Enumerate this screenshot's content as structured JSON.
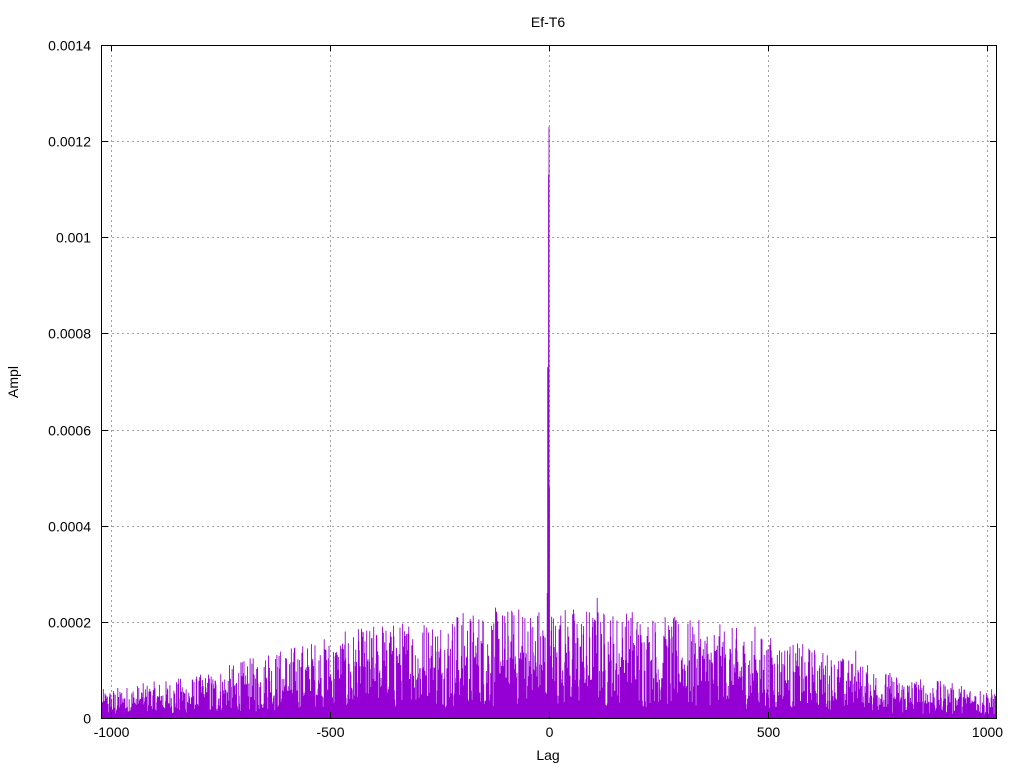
{
  "chart_data": {
    "type": "line",
    "title": "Ef-T6",
    "xlabel": "Lag",
    "ylabel": "Ampl",
    "xlim": [
      -1020,
      1020
    ],
    "ylim": [
      0,
      0.0014
    ],
    "xticks": [
      -1000,
      -500,
      0,
      500,
      1000
    ],
    "xtick_labels": [
      "-1000",
      "-500",
      "0",
      "500",
      "1000"
    ],
    "yticks": [
      0,
      0.0002,
      0.0004,
      0.0006,
      0.0008,
      0.001,
      0.0012,
      0.0014
    ],
    "ytick_labels": [
      "0",
      "0.0002",
      "0.0004",
      "0.0006",
      "0.0008",
      "0.001",
      "0.0012",
      "0.0014"
    ],
    "grid": true,
    "series": [
      {
        "color": "#9400d3",
        "style": "impulses",
        "description": "noisy amplitude per lag from -1020 to 1020 with sharp peak at lag 0",
        "peak": {
          "x": 0,
          "y": 0.00123
        },
        "near_peak": [
          {
            "x": -5,
            "y": 5e-05
          },
          {
            "x": -4,
            "y": 0.00026
          },
          {
            "x": -3,
            "y": 0.00073
          },
          {
            "x": -2,
            "y": 0.0003
          },
          {
            "x": -1,
            "y": 0.00113
          },
          {
            "x": 0,
            "y": 0.00123
          },
          {
            "x": 1,
            "y": 0.00048
          },
          {
            "x": 2,
            "y": 0.00015
          },
          {
            "x": 3,
            "y": 9e-05
          }
        ],
        "notable_peaks": [
          {
            "x": -640,
            "y": 0.00013
          },
          {
            "x": -380,
            "y": 0.00019
          },
          {
            "x": -320,
            "y": 0.00019
          },
          {
            "x": -210,
            "y": 0.00021
          },
          {
            "x": -150,
            "y": 0.0002
          },
          {
            "x": -60,
            "y": 0.00021
          },
          {
            "x": 110,
            "y": 0.00025
          },
          {
            "x": 190,
            "y": 0.00022
          },
          {
            "x": 280,
            "y": 0.00019
          },
          {
            "x": 470,
            "y": 0.00019
          },
          {
            "x": 700,
            "y": 0.00014
          }
        ],
        "envelope": [
          {
            "x": -1020,
            "y": 4e-05
          },
          {
            "x": -800,
            "y": 6e-05
          },
          {
            "x": -600,
            "y": 0.0001
          },
          {
            "x": -400,
            "y": 0.00013
          },
          {
            "x": -200,
            "y": 0.00015
          },
          {
            "x": 0,
            "y": 0.00016
          },
          {
            "x": 200,
            "y": 0.00015
          },
          {
            "x": 400,
            "y": 0.00013
          },
          {
            "x": 600,
            "y": 0.0001
          },
          {
            "x": 800,
            "y": 6e-05
          },
          {
            "x": 1020,
            "y": 4e-05
          }
        ]
      }
    ]
  }
}
